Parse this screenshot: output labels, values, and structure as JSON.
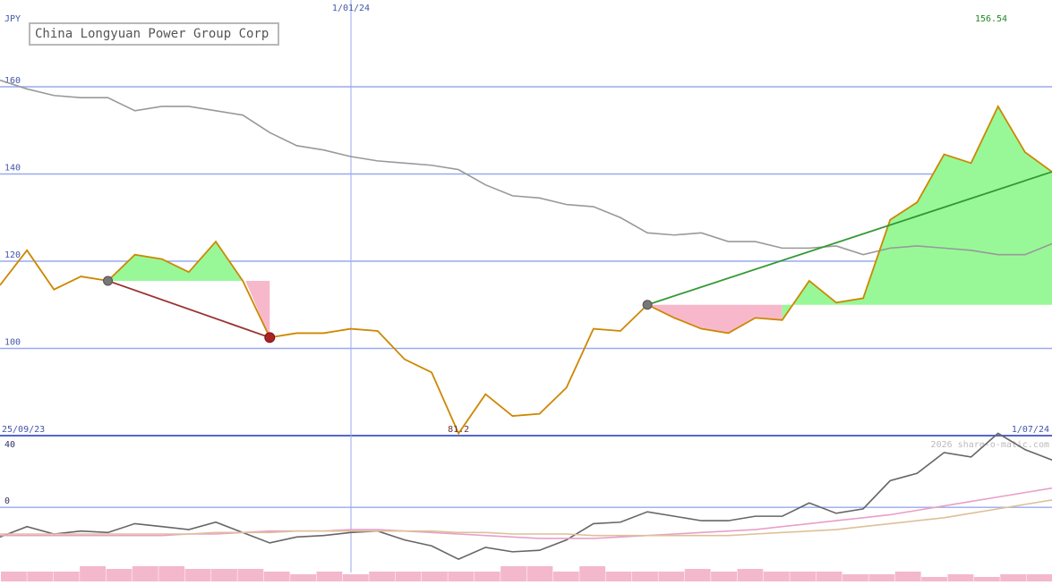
{
  "title": "China Longyuan Power Group Corp",
  "currency": "JPY",
  "watermark": "2026 share-o-matic.com",
  "chart_data": {
    "type": "line",
    "x_start_label": "25/09/23",
    "x_mid_label": "1/01/24",
    "x_end_label": "1/07/24",
    "last_value_label": "156.54",
    "min_value_label": "81.2",
    "upper_panel": {
      "ylim": [
        80,
        160
      ],
      "yticks": [
        "160",
        "140",
        "120",
        "100"
      ],
      "series": [
        {
          "color": "#cc8800",
          "values": [
            114.5,
            122.5,
            113.5,
            116.5,
            115.5,
            121.5,
            120.5,
            117.5,
            124.5,
            115.5,
            102.5,
            103.5,
            103.5,
            104.5,
            104,
            97.5,
            94.5,
            80.5,
            89.5,
            84.5,
            85,
            91,
            104.5,
            104,
            110,
            107,
            104.5,
            103.5,
            107,
            106.5,
            115.5,
            110.5,
            111.5,
            129.5,
            133.5,
            144.5,
            142.5,
            155.5,
            145,
            140.5
          ]
        },
        {
          "color": "#999999",
          "values": [
            161.5,
            159.5,
            158,
            157.5,
            157.5,
            154.5,
            155.5,
            155.5,
            154.5,
            153.5,
            149.5,
            146.5,
            145.5,
            144,
            143,
            142.5,
            142,
            141,
            137.5,
            135,
            134.5,
            133,
            132.5,
            130,
            126.5,
            126,
            126.5,
            124.5,
            124.5,
            123,
            123,
            123.5,
            121.5,
            123,
            123.5,
            123,
            122.5,
            121.5,
            121.5,
            124
          ]
        }
      ],
      "trendlines": [
        {
          "color": "#993333",
          "from": {
            "x": 4,
            "y": 115.5
          },
          "to": {
            "x": 10,
            "y": 102.5
          }
        },
        {
          "color": "#339933",
          "from": {
            "x": 24,
            "y": 110
          },
          "to": {
            "x": 39,
            "y": 140.5
          }
        }
      ]
    },
    "lower_panel": {
      "ylim": [
        -50,
        40
      ],
      "yticks": [
        "40",
        "0",
        "-50"
      ],
      "series": [
        {
          "color": "#666666",
          "values": [
            -20,
            -13,
            -18,
            -16,
            -17,
            -11,
            -13,
            -15,
            -10,
            -17,
            -24,
            -20,
            -19,
            -17,
            -16,
            -22,
            -26,
            -35,
            -27,
            -30,
            -29,
            -22,
            -11,
            -10,
            -3,
            -6,
            -9,
            -9,
            -6,
            -6,
            3,
            -4,
            -1,
            18,
            23,
            37,
            34,
            50,
            39,
            32
          ]
        },
        {
          "color": "#e8a0c8",
          "values": [
            -19,
            -19,
            -19,
            -19,
            -19,
            -19,
            -19,
            -18,
            -18,
            -17,
            -16,
            -16,
            -16,
            -15,
            -15,
            -16,
            -17,
            -18,
            -19,
            -20,
            -21,
            -21,
            -21,
            -20,
            -19,
            -18,
            -17,
            -16,
            -15,
            -13,
            -11,
            -9,
            -7,
            -5,
            -2,
            1,
            4,
            7,
            10,
            13
          ]
        },
        {
          "color": "#ddc09a",
          "values": [
            -18,
            -18,
            -18,
            -18,
            -18,
            -18,
            -18,
            -18,
            -17,
            -17,
            -17,
            -16,
            -16,
            -16,
            -16,
            -16,
            -16,
            -17,
            -17,
            -18,
            -18,
            -18,
            -19,
            -19,
            -19,
            -19,
            -19,
            -19,
            -18,
            -17,
            -16,
            -15,
            -13,
            -11,
            -9,
            -7,
            -4,
            -1,
            2,
            5
          ]
        }
      ],
      "volume_bars": [
        3,
        3,
        3,
        5,
        4,
        5,
        5,
        4,
        4,
        4,
        3,
        2,
        3,
        2,
        3,
        3,
        3,
        3,
        3,
        5,
        5,
        3,
        5,
        3,
        3,
        3,
        4,
        3,
        4,
        3,
        3,
        3,
        2,
        2,
        3,
        1,
        2,
        1,
        2,
        2
      ]
    }
  }
}
